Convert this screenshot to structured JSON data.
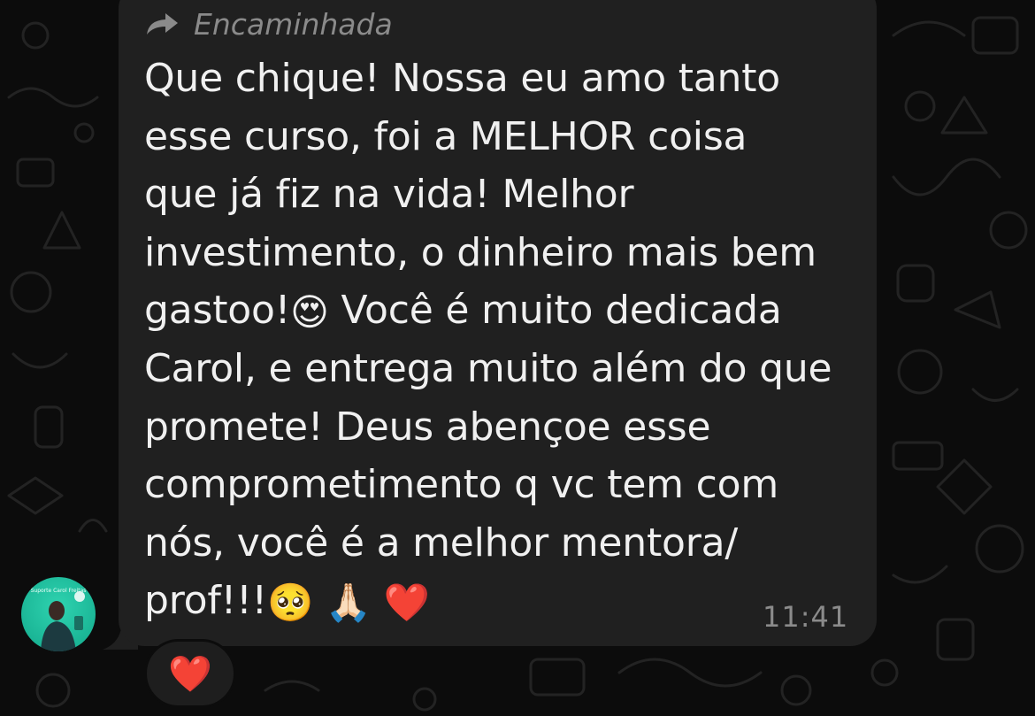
{
  "message": {
    "forwarded_label": "Encaminhada",
    "lines": [
      {
        "text": "Que chique! Nossa eu amo tanto"
      },
      {
        "text": "esse curso, foi a MELHOR coisa"
      },
      {
        "text": "que já fiz na vida! Melhor"
      },
      {
        "text": "investimento, o dinheiro mais bem"
      },
      {
        "text_before": "gastoo!",
        "emoji": "😍",
        "text_after": " Você é muito dedicada"
      },
      {
        "text": "Carol, e entrega muito além do que"
      },
      {
        "text": "promete! Deus abençoe esse"
      },
      {
        "text": "comprometimento q vc tem com"
      },
      {
        "text": "nós, você é a melhor mentora/"
      },
      {
        "text_before": "prof!!!",
        "emojis": [
          "🥺",
          "🙏🏻",
          "❤️"
        ]
      }
    ],
    "timestamp": "11:41"
  },
  "sender": {
    "avatar_caption": "Suporte Carol Freitas"
  },
  "reaction": {
    "emoji": "❤️"
  },
  "colors": {
    "bubble": "#202020",
    "background": "#0c0c0c",
    "text": "#f0f0f0",
    "meta": "#8a8a8a",
    "avatar": "#1fbf9c"
  },
  "icons": {
    "forward": "forward-arrow-icon",
    "wallpaper": "doodle-pattern"
  }
}
